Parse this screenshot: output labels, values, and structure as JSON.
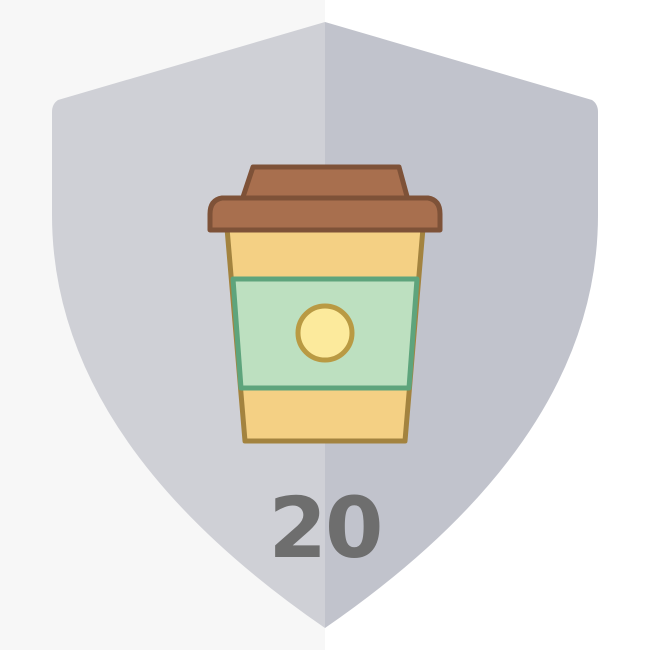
{
  "badge": {
    "count": "20",
    "icon": "coffee-cup-icon",
    "colors": {
      "shield_left": "#cfd0d6",
      "shield_right": "#c1c3cc",
      "count_text": "#6e6e6e",
      "lid": "#a86f4e",
      "lid_stroke": "#7e5238",
      "cup": "#f4d084",
      "cup_stroke": "#a3833f",
      "sleeve": "#bde0c0",
      "sleeve_stroke": "#5ea47c",
      "logo": "#fcea9c",
      "logo_stroke": "#b99a43"
    }
  }
}
